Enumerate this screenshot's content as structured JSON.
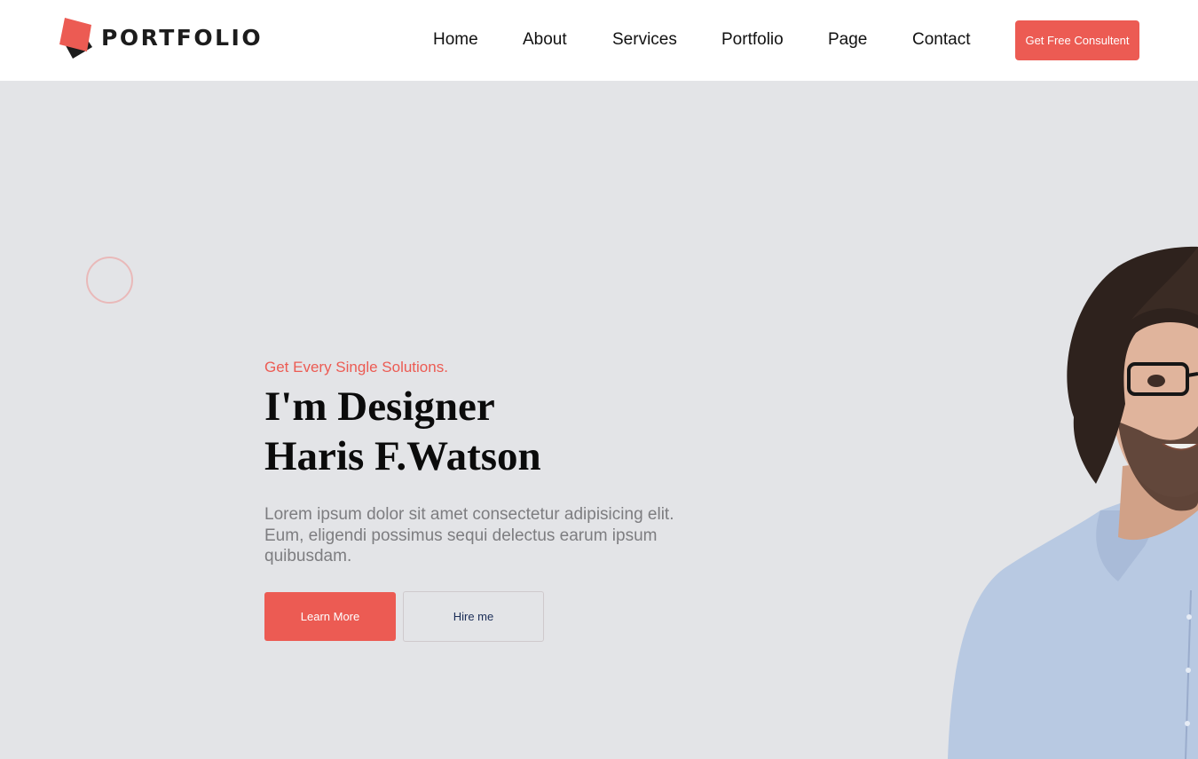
{
  "brand": {
    "name": "PORTFOLIO",
    "logo_icon": "stacked-squares-icon",
    "accent": "#ec5b53"
  },
  "nav": {
    "items": [
      {
        "label": "Home"
      },
      {
        "label": "About"
      },
      {
        "label": "Services"
      },
      {
        "label": "Portfolio"
      },
      {
        "label": "Page"
      },
      {
        "label": "Contact"
      }
    ],
    "cta_label": "Get Free Consultent"
  },
  "hero": {
    "tagline": "Get Every Single Solutions.",
    "headline_line1": "I'm Designer",
    "headline_line2": "Haris F.Watson",
    "description": "Lorem ipsum dolor sit amet consectetur adipisicing elit. Eum, eligendi possimus sequi delectus earum ipsum quibusdam.",
    "primary_button": "Learn More",
    "secondary_button": "Hire me"
  },
  "colors": {
    "accent": "#ec5b53",
    "hero_bg": "#e3e4e7",
    "header_bg": "#ffffff"
  }
}
